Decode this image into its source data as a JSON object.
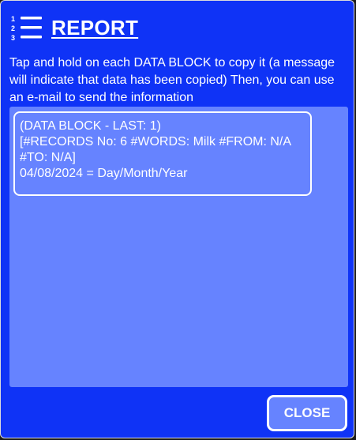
{
  "header": {
    "icon": "numbered-list-icon",
    "icon_digits": [
      "1",
      "2",
      "3"
    ],
    "title": "REPORT"
  },
  "instructions": "Tap and hold on each DATA BLOCK to copy it (a message will indicate that data has been copied) Then, you can use an e-mail to send the information",
  "data_blocks": [
    {
      "lines": [
        "(DATA BLOCK - LAST: 1)",
        "[#RECORDS No: 6 #WORDS: Milk #FROM: N/A",
        "#TO: N/A]",
        "04/08/2024 = Day/Month/Year"
      ]
    }
  ],
  "footer": {
    "close_label": "CLOSE"
  },
  "colors": {
    "dialog_background": "#0f33f6",
    "panel_background": "#6683ff",
    "text": "#ffffff",
    "border": "#ffffff"
  }
}
